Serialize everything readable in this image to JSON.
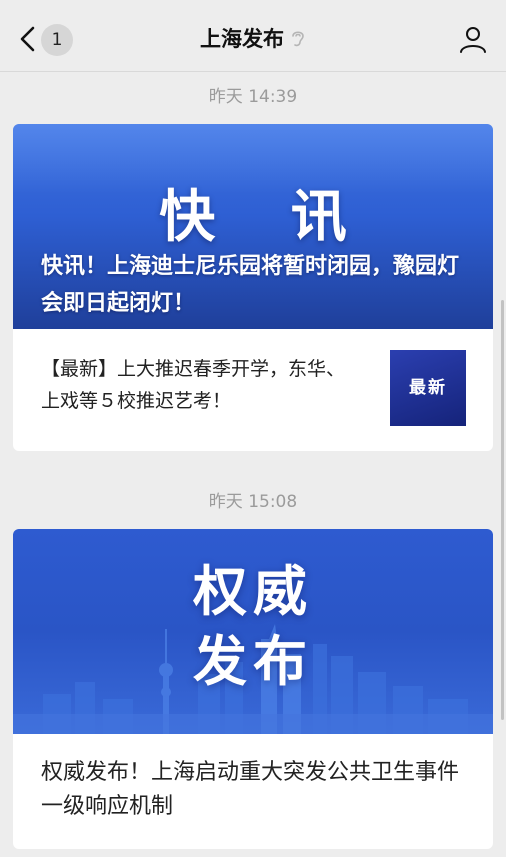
{
  "header": {
    "title": "上海发布",
    "unread_count": "1",
    "back_icon": "chevron-left-icon",
    "profile_icon": "person-icon"
  },
  "messages": [
    {
      "time": "昨天 14:39",
      "cover_big_text": "快 讯",
      "headline": "快讯！上海迪士尼乐园将暂时闭园，豫园灯会即日起闭灯！",
      "sub_item": {
        "text": "【最新】上大推迟春季开学，东华、上戏等５校推迟艺考！",
        "thumb_label": "最新"
      }
    },
    {
      "time": "昨天 15:08",
      "cover_big_line1": "权威",
      "cover_big_line2": "发布",
      "headline": "权威发布！上海启动重大突发公共卫生事件一级响应机制"
    }
  ],
  "colors": {
    "cover_blue": "#2e5fd3",
    "thumb_navy": "#1a2a8c",
    "background": "#ededed"
  }
}
